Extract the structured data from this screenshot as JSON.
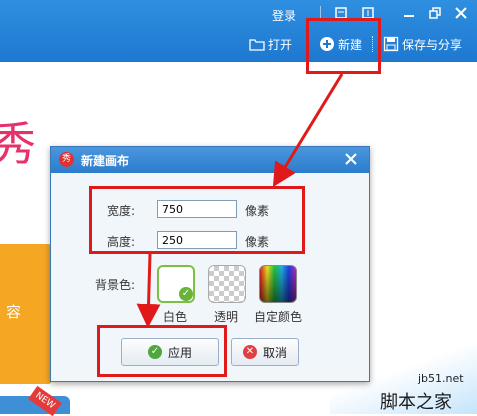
{
  "topbar": {
    "login_label": "登录",
    "window_buttons": [
      "menu-icon",
      "skin-icon",
      "minimize-icon",
      "restore-icon",
      "close-icon"
    ],
    "open_label": "打开",
    "new_label": "新建",
    "save_share_label": "保存与分享"
  },
  "background": {
    "pink_char": "秀",
    "side_text": "容",
    "badge_text": "NEW"
  },
  "dialog": {
    "logo_text": "秀",
    "title": "新建画布",
    "width_label": "宽度:",
    "width_value": "750",
    "width_unit": "像素",
    "height_label": "高度:",
    "height_value": "250",
    "height_unit": "像素",
    "bg_label": "背景色:",
    "swatches": [
      {
        "label": "白色",
        "selected": true,
        "color": "#ffffff"
      },
      {
        "label": "透明",
        "selected": false,
        "color": "transparent"
      },
      {
        "label": "自定颜色",
        "selected": false,
        "color": "gradient"
      }
    ],
    "apply_label": "应用",
    "cancel_label": "取消"
  },
  "watermark": {
    "url": "jb51.net",
    "name": "脚本之家"
  },
  "colors": {
    "topbar": "#2a86d9",
    "highlight": "#e01a1a",
    "dialog_title": "#3a8ad6",
    "accent_orange": "#f5a623",
    "accent_pink": "#e8306a"
  }
}
